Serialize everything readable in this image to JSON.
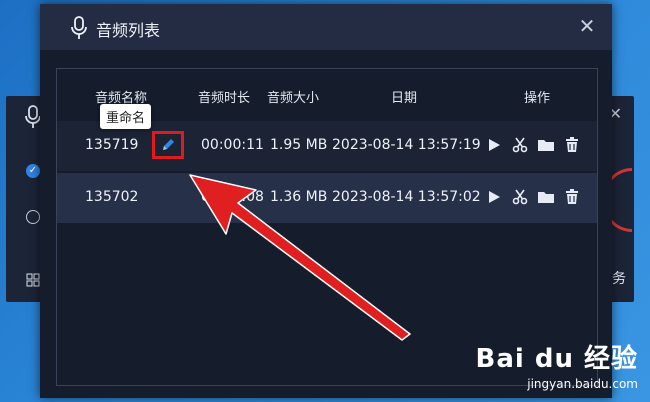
{
  "background_window": {
    "right_text": "务"
  },
  "dialog": {
    "title": "音频列表",
    "close_glyph": "✕"
  },
  "table": {
    "columns": [
      "音频名称",
      "音频时长",
      "音频大小",
      "日期",
      "操作"
    ],
    "rows": [
      {
        "name": "135719",
        "duration": "00:00:11",
        "size": "1.95 MB",
        "date": "2023-08-14 13:57:19"
      },
      {
        "name": "135702",
        "duration": "00:00:08",
        "size": "1.36 MB",
        "date": "2023-08-14 13:57:02"
      }
    ],
    "row_actions": [
      "play-icon",
      "scissors-icon",
      "folder-icon",
      "trash-icon"
    ]
  },
  "tooltip": {
    "text": "重命名"
  },
  "watermark": {
    "logo": "Bai du 经验",
    "url": "jingyan.baidu.com"
  },
  "colors": {
    "highlight_border": "#e01b1b",
    "arrow": "#e02020",
    "accent_blue": "#2f86e6"
  }
}
